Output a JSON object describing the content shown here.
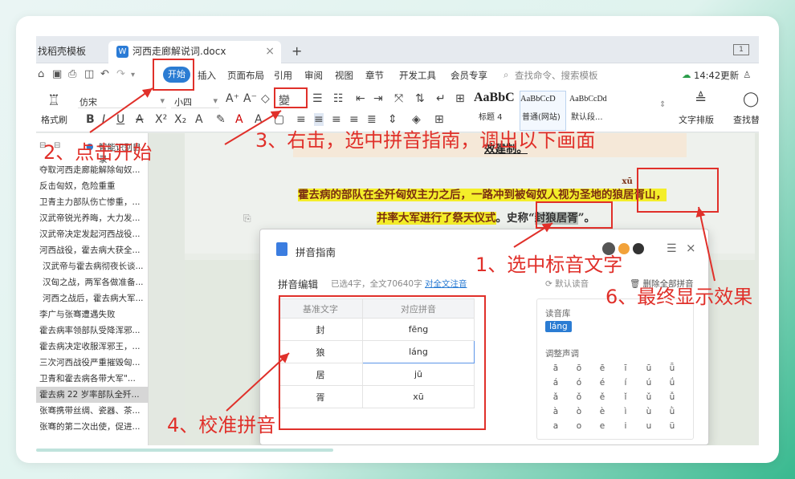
{
  "tabs": [
    {
      "label": "找稻壳模板"
    },
    {
      "label": "河西走廊解说词.docx",
      "icon": "W"
    }
  ],
  "new_tab": "+",
  "close_tab": "×",
  "window_icon": "1",
  "menu": {
    "start": "开始",
    "items": [
      "插入",
      "页面布局",
      "引用",
      "审阅",
      "视图",
      "章节",
      "开发工具",
      "会员专享"
    ],
    "search": "查找命令、搜索模板",
    "time_update": "14:42更新"
  },
  "ribbon": {
    "format_painter": "格式刷",
    "font_name": "仿宋",
    "font_size": "小四",
    "styles": [
      {
        "preview": "AaBbC",
        "name": "标题 4"
      },
      {
        "preview": "AaBbCcD",
        "name": "普通(网站)"
      },
      {
        "preview": "AaBbCcDd",
        "name": "默认段..."
      }
    ],
    "text_layout": "文字排版",
    "find_replace": "查找替"
  },
  "nav": {
    "title": "智能识别目录",
    "items": [
      "夺取河西走廊能解除匈奴...",
      "反击匈奴，危险重重",
      "卫青主力部队伤亡惨重，...",
      "汉武帝锐光养晦，大力发...",
      "汉武帝决定发起河西战役...",
      "河西战役，霍去病大获全...",
      "汉武帝与霍去病彻夜长谈...",
      "汉匈之战，两军各做准备...",
      "河西之战后，霍去病大军...",
      "李广与张骞遭遇失败",
      "霍去病率领部队受降浑邪...",
      "霍去病决定收服浑邪王，...",
      "三次河西战役严重摧毁匈...",
      "卫青和霍去病各带大军\"...",
      "霍去病 22 岁率部队全歼...",
      "张骞携带丝绸、瓷器、茶...",
      "张骞的第二次出使，促进..."
    ],
    "selected_index": 14
  },
  "doc": {
    "line0": "效建制。",
    "line1a": "霍去病的部队在全歼匈奴主力之后，一路冲到被匈奴人视为圣地的",
    "line1b": "狼居胥",
    "line1c": "山，",
    "ruby": "xū",
    "line2a": "并率大军进行了祭天仪式",
    "line2b": "。史称“",
    "line2c": "封狼居胥",
    "line2d": "”。"
  },
  "dialog": {
    "title": "拼音指南",
    "edit_label": "拼音编辑",
    "selected_info": "已选4字，全文70640字",
    "full_text_link": "对全文注音",
    "default_pinyin": "默认读音",
    "delete_all": "删除全部拼音",
    "col_base": "基准文字",
    "col_pinyin": "对应拼音",
    "rows": [
      {
        "char": "封",
        "pinyin": "fēng"
      },
      {
        "char": "狼",
        "pinyin": "láng"
      },
      {
        "char": "居",
        "pinyin": "jū"
      },
      {
        "char": "胥",
        "pinyin": "xū"
      }
    ],
    "reading_label": "读音库",
    "reading_value": "láng",
    "tone_label": "调整声调",
    "tones": [
      [
        "ā",
        "ō",
        "ē",
        "ī",
        "ū",
        "ǖ"
      ],
      [
        "á",
        "ó",
        "é",
        "í",
        "ú",
        "ǘ"
      ],
      [
        "ǎ",
        "ǒ",
        "ě",
        "ǐ",
        "ǔ",
        "ǚ"
      ],
      [
        "à",
        "ò",
        "è",
        "ì",
        "ù",
        "ǜ"
      ],
      [
        "a",
        "o",
        "e",
        "i",
        "u",
        "ü"
      ]
    ]
  },
  "annotations": {
    "a1": "1、选中标音文字",
    "a2": "2、点击开始",
    "a3": "3、右击，选中拼音指南，调出以下画面",
    "a4": "4、校准拼音",
    "a6": "6、最终显示效果"
  },
  "colors": {
    "accent": "#2b7cd3",
    "annotation_red": "#e0302a",
    "highlight_yellow": "#f4ee2a",
    "background_green": "#38b98f"
  }
}
